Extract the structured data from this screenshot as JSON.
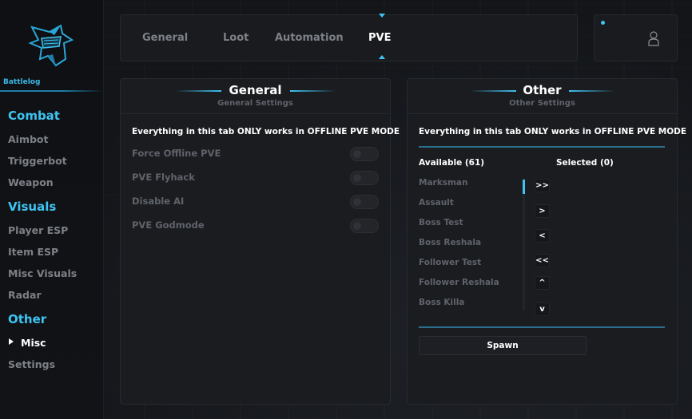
{
  "sidebar": {
    "brand": "Battlelog",
    "sections": [
      {
        "title": "Combat",
        "items": [
          "Aimbot",
          "Triggerbot",
          "Weapon"
        ]
      },
      {
        "title": "Visuals",
        "items": [
          "Player ESP",
          "Item ESP",
          "Misc Visuals",
          "Radar"
        ]
      },
      {
        "title": "Other",
        "items": [
          "Misc",
          "Settings"
        ]
      }
    ],
    "active_item": "Misc"
  },
  "tabs": [
    "General",
    "Loot",
    "Automation",
    "PVE"
  ],
  "active_tab": "PVE",
  "general_panel": {
    "title": "General",
    "subtitle": "General Settings",
    "notice": "Everything in this tab ONLY works in OFFLINE PVE MODE",
    "options": [
      {
        "label": "Force Offline PVE",
        "enabled": false
      },
      {
        "label": "PVE Flyhack",
        "enabled": false
      },
      {
        "label": "Disable AI",
        "enabled": false
      },
      {
        "label": "PVE Godmode",
        "enabled": false
      }
    ]
  },
  "other_panel": {
    "title": "Other",
    "subtitle": "Other Settings",
    "notice": "Everything in this tab ONLY works in OFFLINE PVE MODE",
    "available_label": "Available (61)",
    "selected_label": "Selected (0)",
    "available_items": [
      "Marksman",
      "Assault",
      "Boss Test",
      "Boss Reshala",
      "Follower Test",
      "Follower Reshala",
      "Boss Killa"
    ],
    "move_buttons": [
      ">>",
      ">",
      "<",
      "<<",
      "^",
      "v"
    ],
    "spawn_label": "Spawn"
  },
  "colors": {
    "accent": "#3ec4f2",
    "panel": "#1a1c20",
    "muted": "#5f636a"
  }
}
